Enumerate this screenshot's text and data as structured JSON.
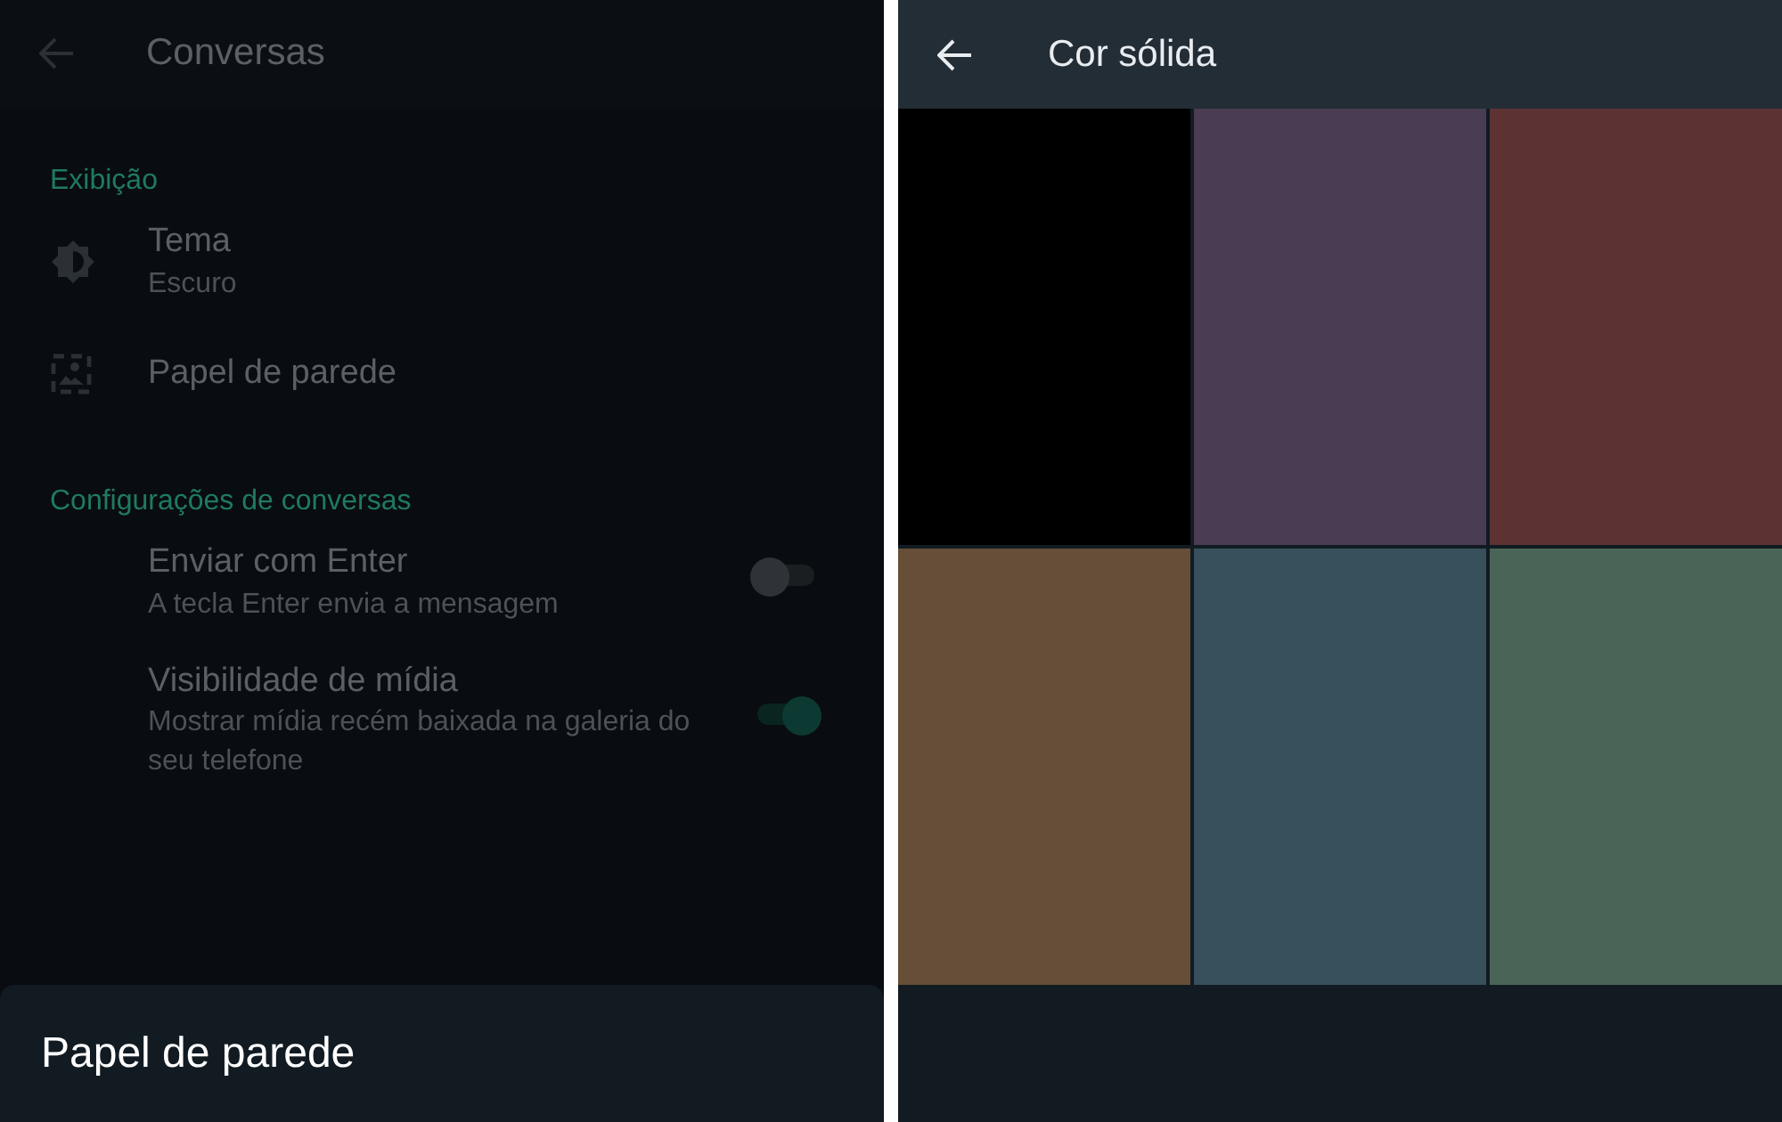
{
  "settings": {
    "title": "Conversas",
    "sections": [
      {
        "heading": "Exibição",
        "items": [
          {
            "kind": "theme",
            "title": "Tema",
            "subtitle": "Escuro"
          },
          {
            "kind": "wallpaper",
            "title": "Papel de parede"
          }
        ]
      },
      {
        "heading": "Configurações de conversas",
        "items": [
          {
            "kind": "toggle",
            "title": "Enviar com Enter",
            "subtitle": "A tecla Enter envia a mensagem",
            "on": false
          },
          {
            "kind": "toggle",
            "title": "Visibilidade de mídia",
            "subtitle": "Mostrar mídia recém baixada na galeria do seu telefone",
            "on": true
          }
        ]
      }
    ]
  },
  "sheet": {
    "title": "Papel de parede"
  },
  "solid_color": {
    "title": "Cor sólida",
    "swatches": [
      {
        "color": "#000000"
      },
      {
        "color": "#4a3c52"
      },
      {
        "color": "#5c3233"
      },
      {
        "color": "#664e38"
      },
      {
        "color": "#37505c"
      },
      {
        "color": "#4a6558"
      }
    ]
  }
}
